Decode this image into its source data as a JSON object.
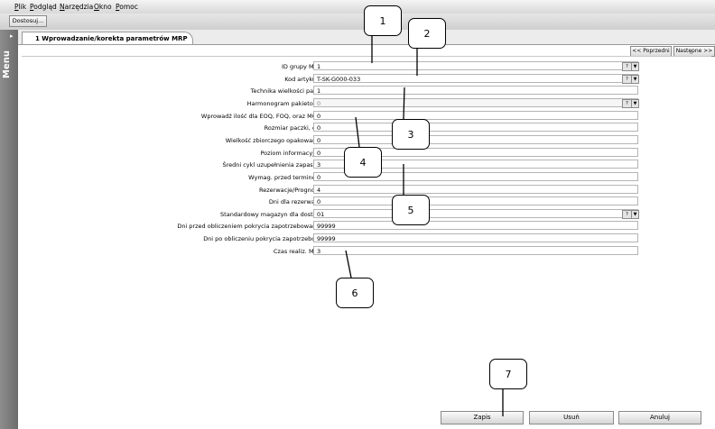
{
  "menubar": {
    "items": [
      {
        "label": "Plik"
      },
      {
        "label": "Podgląd"
      },
      {
        "label": "Narzędzia"
      },
      {
        "label": "Okno"
      },
      {
        "label": "Pomoc"
      }
    ]
  },
  "toolbar": {
    "customize_label": "Dostosuj..."
  },
  "sidebar": {
    "label": "Menu",
    "pin_icon": "pin-icon"
  },
  "tab": {
    "title": "1 Wprowadzanie/korekta parametrów MRP"
  },
  "nav": {
    "prev_label": "<< Poprzedni",
    "next_label": "Następne >>"
  },
  "form": {
    "fields": [
      {
        "label": "ID grupy MRP",
        "value": "1"
      },
      {
        "label": "Kod artykułu",
        "value": "T-SK-G000-033"
      },
      {
        "label": "Technika wielkości partii",
        "value": "1"
      },
      {
        "label": "Harmonogram pakietowy",
        "value": "0"
      },
      {
        "label": "Wprowadź ilość dla EOQ, FOQ, oraz MOQ",
        "value": "0"
      },
      {
        "label": "Rozmiar paczki, dni",
        "value": "0"
      },
      {
        "label": "Wielkość zbiorczego opakowania",
        "value": "0"
      },
      {
        "label": "Poziom informacyjny",
        "value": "0"
      },
      {
        "label": "Średni cykl uzupełnienia zapasów",
        "value": "3"
      },
      {
        "label": "Wymag. przed terminem",
        "value": "0"
      },
      {
        "label": "Rezerwacje/Prognozy",
        "value": "4"
      },
      {
        "label": "Dni dla rezerwacji",
        "value": "0"
      },
      {
        "label": "Standardowy magazyn dla dostaw",
        "value": "01"
      },
      {
        "label": "Dni przed obliczeniem pokrycia zapotrzebowania",
        "value": "99999"
      },
      {
        "label": "Dni po obliczeniu pokrycia zapotrzebow.",
        "value": "99999"
      },
      {
        "label": "Czas realiz. MRP",
        "value": "3"
      }
    ],
    "lookup_label": "?",
    "dropdown_glyph": "▼"
  },
  "buttons": {
    "save_label": "Zapis",
    "delete_label": "Usuń",
    "cancel_label": "Anuluj"
  },
  "callouts": [
    "1",
    "2",
    "3",
    "4",
    "5",
    "6",
    "7"
  ]
}
